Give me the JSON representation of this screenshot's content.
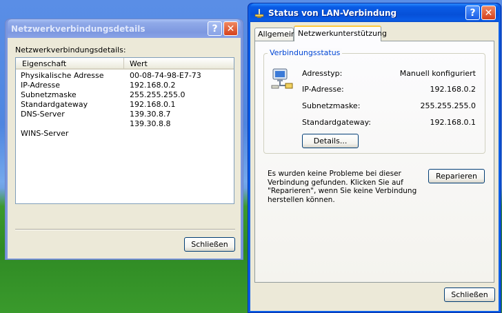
{
  "details_window": {
    "title": "Netzwerkverbindungsdetails",
    "help_button": "?",
    "close_button": "✕",
    "heading": "Netzwerkverbindungsdetails:",
    "columns": [
      "Eigenschaft",
      "Wert"
    ],
    "rows": [
      {
        "property": "Physikalische Adresse",
        "value": "00-08-74-98-E7-73"
      },
      {
        "property": "IP-Adresse",
        "value": "192.168.0.2"
      },
      {
        "property": "Subnetzmaske",
        "value": "255.255.255.0"
      },
      {
        "property": "Standardgateway",
        "value": "192.168.0.1"
      },
      {
        "property": "DNS-Server",
        "value": "139.30.8.7"
      },
      {
        "property": "",
        "value": "139.30.8.8"
      },
      {
        "property": "WINS-Server",
        "value": ""
      }
    ],
    "close_label": "Schließen"
  },
  "status_window": {
    "title": "Status von LAN-Verbindung",
    "help_button": "?",
    "close_button": "✕",
    "tabs": [
      "Allgemein",
      "Netzwerkunterstützung"
    ],
    "active_tab": "Netzwerkunterstützung",
    "group_title": "Verbindungsstatus",
    "fields": [
      {
        "label": "Adresstyp:",
        "value": "Manuell konfiguriert"
      },
      {
        "label": "IP-Adresse:",
        "value": "192.168.0.2"
      },
      {
        "label": "Subnetzmaske:",
        "value": "255.255.255.0"
      },
      {
        "label": "Standardgateway:",
        "value": "192.168.0.1"
      }
    ],
    "details_button": "Details...",
    "problem_text_lines": [
      "Es wurden keine Probleme bei dieser",
      "Verbindung gefunden. Klicken Sie auf",
      "\"Reparieren\", wenn Sie keine Verbindung",
      "herstellen können."
    ],
    "repair_button": "Reparieren",
    "close_label": "Schließen"
  },
  "colors": {
    "titlebar_active": "#0a5ce6",
    "titlebar_inactive": "#7a96df",
    "dialog_face": "#ece9d8",
    "group_title": "#0046d5"
  }
}
